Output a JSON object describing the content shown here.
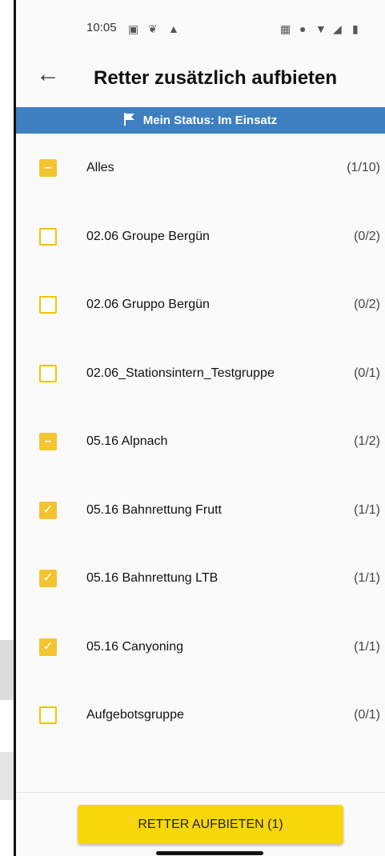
{
  "status_bar": {
    "time": "10:05",
    "left_icons": [
      "message-icon",
      "leaf-icon",
      "car-icon"
    ],
    "right_icons": [
      "nfc-icon",
      "location-icon",
      "wifi-icon",
      "signal-icon",
      "battery-icon"
    ]
  },
  "header": {
    "back_icon": "arrow-left-icon",
    "title": "Retter zusätzlich aufbieten"
  },
  "status_banner": {
    "text": "Mein Status: Im Einsatz",
    "icon": "flag-icon",
    "color": "#3d7fc0"
  },
  "groups": [
    {
      "label": "Alles",
      "count": "(1/10)",
      "state": "partial"
    },
    {
      "label": "02.06 Groupe Bergün",
      "count": "(0/2)",
      "state": "unchecked"
    },
    {
      "label": "02.06 Gruppo Bergün",
      "count": "(0/2)",
      "state": "unchecked"
    },
    {
      "label": "02.06_Stationsintern_Testgruppe",
      "count": "(0/1)",
      "state": "unchecked"
    },
    {
      "label": "05.16 Alpnach",
      "count": "(1/2)",
      "state": "partial"
    },
    {
      "label": "05.16 Bahnrettung Frutt",
      "count": "(1/1)",
      "state": "checked"
    },
    {
      "label": "05.16 Bahnrettung LTB",
      "count": "(1/1)",
      "state": "checked"
    },
    {
      "label": "05.16 Canyoning",
      "count": "(1/1)",
      "state": "checked"
    },
    {
      "label": "Aufgebotsgruppe",
      "count": "(0/1)",
      "state": "unchecked"
    }
  ],
  "action_button": {
    "label": "RETTER AUFBIETEN (1)",
    "color": "#f7d70a"
  },
  "accent_color": "#f4c430"
}
